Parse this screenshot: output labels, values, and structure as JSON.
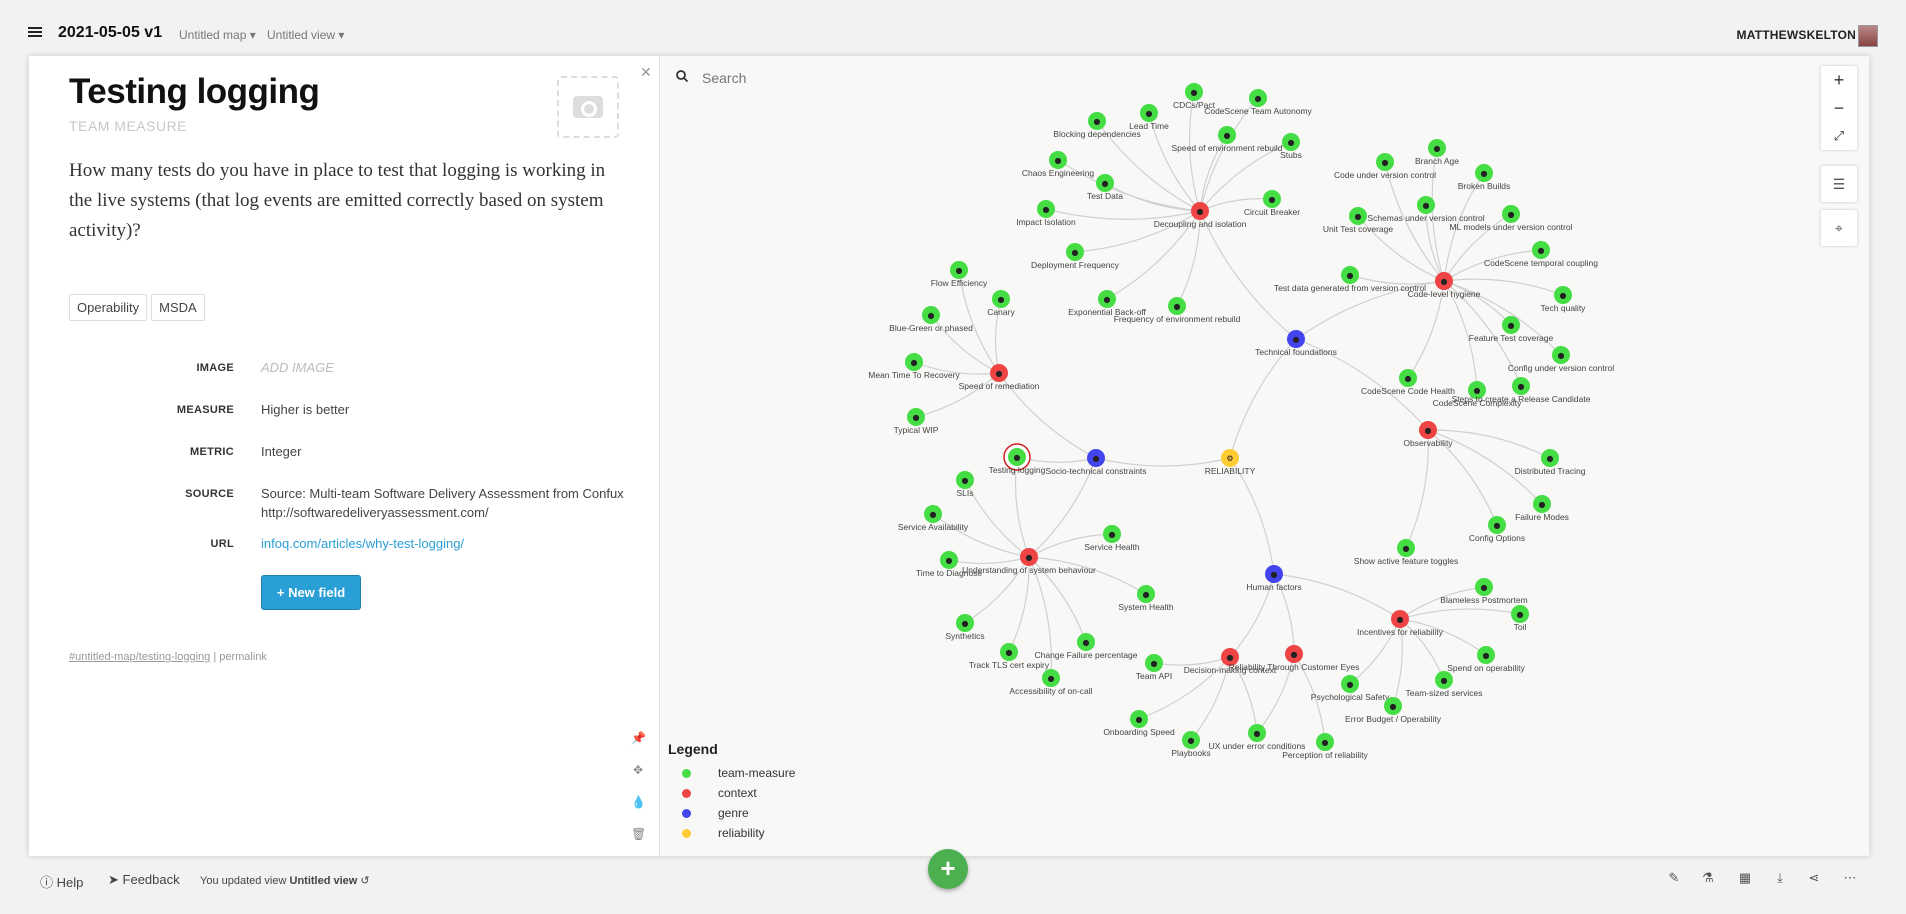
{
  "header": {
    "title": "2021-05-05 v1",
    "map_dropdown": "Untitled map",
    "view_dropdown": "Untitled view",
    "user": "MATTHEWSKELTON"
  },
  "panel": {
    "title": "Testing logging",
    "subtitle": "TEAM MEASURE",
    "description": "How many tests do you have in place to test that logging is working in the live systems (that log events are emitted correctly based on system activity)?",
    "tags": [
      "Operability",
      "MSDA"
    ],
    "fields": {
      "image_label": "IMAGE",
      "image_value": "ADD IMAGE",
      "measure_label": "MEASURE",
      "measure_value": "Higher is better",
      "metric_label": "METRIC",
      "metric_value": "Integer",
      "source_label": "SOURCE",
      "source_value": "Source: Multi-team Software Delivery Assessment from Confux http://softwaredeliveryassessment.com/",
      "url_label": "URL",
      "url_value": "infoq.com/articles/why-test-logging/"
    },
    "new_field_label": "+ New field",
    "permalink_hash": "#untitled-map/testing-logging",
    "permalink_sep": " | ",
    "permalink_label": "permalink"
  },
  "map": {
    "search_placeholder": "Search",
    "legend_title": "Legend",
    "legend": [
      {
        "label": "team-measure",
        "color": "#44dd44"
      },
      {
        "label": "context",
        "color": "#ee4444"
      },
      {
        "label": "genre",
        "color": "#4444ee"
      },
      {
        "label": "reliability",
        "color": "#ffcc33"
      }
    ],
    "colors": {
      "team-measure": "#44dd44",
      "context": "#ee4444",
      "genre": "#4444ee",
      "reliability": "#ffcc33"
    },
    "nodes": [
      {
        "id": "reliability",
        "label": "RELIABILITY",
        "type": "reliability"
      },
      {
        "id": "tech",
        "label": "Technical foundations",
        "type": "genre"
      },
      {
        "id": "socio",
        "label": "Socio-technical constraints",
        "type": "genre"
      },
      {
        "id": "human",
        "label": "Human factors",
        "type": "genre"
      },
      {
        "id": "decoupling",
        "label": "Decoupling and isolation",
        "type": "context"
      },
      {
        "id": "codehyg",
        "label": "Code-level hygiene",
        "type": "context"
      },
      {
        "id": "obs",
        "label": "Observability",
        "type": "context"
      },
      {
        "id": "speed",
        "label": "Speed of remediation",
        "type": "context"
      },
      {
        "id": "understanding",
        "label": "Understanding of system behaviour",
        "type": "context"
      },
      {
        "id": "incentives",
        "label": "Incentives for reliability",
        "type": "context"
      },
      {
        "id": "decision",
        "label": "Decision-making context",
        "type": "context"
      },
      {
        "id": "rtce",
        "label": "Reliability Through Customer Eyes",
        "type": "context"
      },
      {
        "id": "m1",
        "label": "CDCs/Pact",
        "type": "team-measure"
      },
      {
        "id": "m2",
        "label": "CodeScene Team Autonomy",
        "type": "team-measure"
      },
      {
        "id": "m3",
        "label": "Lead Time",
        "type": "team-measure"
      },
      {
        "id": "m4",
        "label": "Blocking dependencies",
        "type": "team-measure"
      },
      {
        "id": "m5",
        "label": "Speed of environment rebuild",
        "type": "team-measure"
      },
      {
        "id": "m6",
        "label": "Stubs",
        "type": "team-measure"
      },
      {
        "id": "m7",
        "label": "Chaos Engineering",
        "type": "team-measure"
      },
      {
        "id": "m8",
        "label": "Test Data",
        "type": "team-measure"
      },
      {
        "id": "m9",
        "label": "Circuit Breaker",
        "type": "team-measure"
      },
      {
        "id": "m10",
        "label": "Impact Isolation",
        "type": "team-measure"
      },
      {
        "id": "m11",
        "label": "Deployment Frequency",
        "type": "team-measure"
      },
      {
        "id": "m12",
        "label": "Exponential Back-off",
        "type": "team-measure"
      },
      {
        "id": "m13",
        "label": "Frequency of environment rebuild",
        "type": "team-measure"
      },
      {
        "id": "m14",
        "label": "Branch Age",
        "type": "team-measure"
      },
      {
        "id": "m15",
        "label": "Code under version control",
        "type": "team-measure"
      },
      {
        "id": "m16",
        "label": "Broken Builds",
        "type": "team-measure"
      },
      {
        "id": "m17",
        "label": "Schemas under version control",
        "type": "team-measure"
      },
      {
        "id": "m18",
        "label": "ML models under version control",
        "type": "team-measure"
      },
      {
        "id": "m19",
        "label": "Unit Test coverage",
        "type": "team-measure"
      },
      {
        "id": "m20",
        "label": "CodeScene temporal coupling",
        "type": "team-measure"
      },
      {
        "id": "m21",
        "label": "Test data generated from version control",
        "type": "team-measure"
      },
      {
        "id": "m22",
        "label": "Tech quality",
        "type": "team-measure"
      },
      {
        "id": "m23",
        "label": "Feature Test coverage",
        "type": "team-measure"
      },
      {
        "id": "m24",
        "label": "Config under version control",
        "type": "team-measure"
      },
      {
        "id": "m25",
        "label": "CodeScene Code Health",
        "type": "team-measure"
      },
      {
        "id": "m26",
        "label": "CodeScene Complexity",
        "type": "team-measure"
      },
      {
        "id": "m27",
        "label": "Steps to create a Release Candidate",
        "type": "team-measure"
      },
      {
        "id": "m28",
        "label": "Flow Efficiency",
        "type": "team-measure"
      },
      {
        "id": "m29",
        "label": "Canary",
        "type": "team-measure"
      },
      {
        "id": "m30",
        "label": "Blue-Green or phased",
        "type": "team-measure"
      },
      {
        "id": "m31",
        "label": "Mean Time To Recovery",
        "type": "team-measure"
      },
      {
        "id": "m32",
        "label": "Typical WIP",
        "type": "team-measure"
      },
      {
        "id": "m33",
        "label": "Testing logging",
        "type": "team-measure",
        "selected": true
      },
      {
        "id": "m34",
        "label": "SLIs",
        "type": "team-measure"
      },
      {
        "id": "m35",
        "label": "Service Availability",
        "type": "team-measure"
      },
      {
        "id": "m36",
        "label": "Service Health",
        "type": "team-measure"
      },
      {
        "id": "m37",
        "label": "Time to Diagnose",
        "type": "team-measure"
      },
      {
        "id": "m38",
        "label": "System Health",
        "type": "team-measure"
      },
      {
        "id": "m39",
        "label": "Synthetics",
        "type": "team-measure"
      },
      {
        "id": "m40",
        "label": "Change Failure percentage",
        "type": "team-measure"
      },
      {
        "id": "m41",
        "label": "Track TLS cert expiry",
        "type": "team-measure"
      },
      {
        "id": "m42",
        "label": "Accessibility of on-call",
        "type": "team-measure"
      },
      {
        "id": "m43",
        "label": "Distributed Tracing",
        "type": "team-measure"
      },
      {
        "id": "m44",
        "label": "Failure Modes",
        "type": "team-measure"
      },
      {
        "id": "m45",
        "label": "Config Options",
        "type": "team-measure"
      },
      {
        "id": "m46",
        "label": "Show active feature toggles",
        "type": "team-measure"
      },
      {
        "id": "m47",
        "label": "Blameless Postmortem",
        "type": "team-measure"
      },
      {
        "id": "m48",
        "label": "Toil",
        "type": "team-measure"
      },
      {
        "id": "m49",
        "label": "Spend on operability",
        "type": "team-measure"
      },
      {
        "id": "m50",
        "label": "Team-sized services",
        "type": "team-measure"
      },
      {
        "id": "m51",
        "label": "Psychological Safety",
        "type": "team-measure"
      },
      {
        "id": "m52",
        "label": "Error Budget / Operability",
        "type": "team-measure"
      },
      {
        "id": "m53",
        "label": "Team API",
        "type": "team-measure"
      },
      {
        "id": "m54",
        "label": "Onboarding Speed",
        "type": "team-measure"
      },
      {
        "id": "m55",
        "label": "Playbooks",
        "type": "team-measure"
      },
      {
        "id": "m56",
        "label": "UX under error conditions",
        "type": "team-measure"
      },
      {
        "id": "m57",
        "label": "Perception of reliability",
        "type": "team-measure"
      }
    ],
    "edges": [
      [
        "reliability",
        "tech"
      ],
      [
        "reliability",
        "socio"
      ],
      [
        "reliability",
        "human"
      ],
      [
        "tech",
        "decoupling"
      ],
      [
        "tech",
        "codehyg"
      ],
      [
        "tech",
        "obs"
      ],
      [
        "socio",
        "speed"
      ],
      [
        "socio",
        "understanding"
      ],
      [
        "socio",
        "m33"
      ],
      [
        "human",
        "incentives"
      ],
      [
        "human",
        "decision"
      ],
      [
        "human",
        "rtce"
      ],
      [
        "decoupling",
        "m1"
      ],
      [
        "decoupling",
        "m2"
      ],
      [
        "decoupling",
        "m3"
      ],
      [
        "decoupling",
        "m4"
      ],
      [
        "decoupling",
        "m5"
      ],
      [
        "decoupling",
        "m6"
      ],
      [
        "decoupling",
        "m7"
      ],
      [
        "decoupling",
        "m8"
      ],
      [
        "decoupling",
        "m9"
      ],
      [
        "decoupling",
        "m10"
      ],
      [
        "decoupling",
        "m11"
      ],
      [
        "decoupling",
        "m12"
      ],
      [
        "decoupling",
        "m13"
      ],
      [
        "codehyg",
        "m14"
      ],
      [
        "codehyg",
        "m15"
      ],
      [
        "codehyg",
        "m16"
      ],
      [
        "codehyg",
        "m17"
      ],
      [
        "codehyg",
        "m18"
      ],
      [
        "codehyg",
        "m19"
      ],
      [
        "codehyg",
        "m20"
      ],
      [
        "codehyg",
        "m21"
      ],
      [
        "codehyg",
        "m22"
      ],
      [
        "codehyg",
        "m23"
      ],
      [
        "codehyg",
        "m24"
      ],
      [
        "codehyg",
        "m25"
      ],
      [
        "codehyg",
        "m26"
      ],
      [
        "codehyg",
        "m27"
      ],
      [
        "speed",
        "m28"
      ],
      [
        "speed",
        "m29"
      ],
      [
        "speed",
        "m30"
      ],
      [
        "speed",
        "m31"
      ],
      [
        "speed",
        "m32"
      ],
      [
        "understanding",
        "m33"
      ],
      [
        "understanding",
        "m34"
      ],
      [
        "understanding",
        "m35"
      ],
      [
        "understanding",
        "m36"
      ],
      [
        "understanding",
        "m37"
      ],
      [
        "understanding",
        "m38"
      ],
      [
        "understanding",
        "m39"
      ],
      [
        "understanding",
        "m40"
      ],
      [
        "understanding",
        "m41"
      ],
      [
        "understanding",
        "m42"
      ],
      [
        "obs",
        "m43"
      ],
      [
        "obs",
        "m44"
      ],
      [
        "obs",
        "m45"
      ],
      [
        "obs",
        "m46"
      ],
      [
        "incentives",
        "m47"
      ],
      [
        "incentives",
        "m48"
      ],
      [
        "incentives",
        "m49"
      ],
      [
        "incentives",
        "m50"
      ],
      [
        "incentives",
        "m51"
      ],
      [
        "incentives",
        "m52"
      ],
      [
        "decision",
        "m53"
      ],
      [
        "decision",
        "m54"
      ],
      [
        "decision",
        "m55"
      ],
      [
        "decision",
        "m56"
      ],
      [
        "rtce",
        "m57"
      ],
      [
        "rtce",
        "m56"
      ]
    ]
  },
  "bottom": {
    "help": "Help",
    "feedback": "Feedback",
    "status_prefix": "You updated view ",
    "status_view": "Untitled view",
    "fab": "+"
  }
}
